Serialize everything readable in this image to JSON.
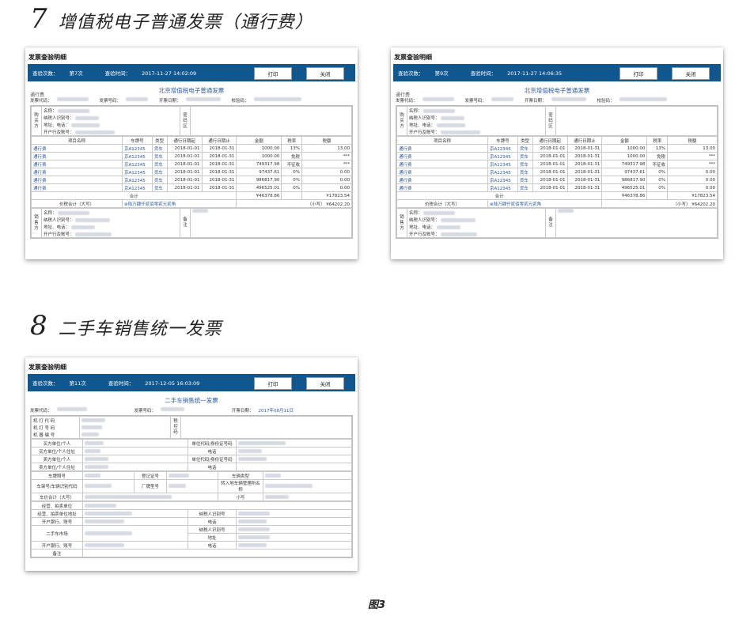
{
  "sections": [
    {
      "num": "7",
      "title": "增值税电子普通发票（通行费）"
    },
    {
      "num": "8",
      "title": "二手车销售统一发票"
    }
  ],
  "card_common": {
    "head": "发票查验明细",
    "print": "打印",
    "close": "关闭",
    "count_label": "查验次数：",
    "time_label": "查验时间："
  },
  "toll": {
    "tag": "通行费",
    "title": "北京增值税电子普通发票",
    "meta": [
      "发票代码：",
      "发票号码：",
      "开票日期：",
      "校验码："
    ],
    "buyer_label": "购买方",
    "buyer_fields": [
      "名称：",
      "纳税人识别号：",
      "地址、电话：",
      "开户行及账号："
    ],
    "pw_label": "密码区",
    "headers": [
      "项目名称",
      "车牌号",
      "类型",
      "通行日期起",
      "通行日期止",
      "金额",
      "税率",
      "税额"
    ],
    "rows": [
      [
        "通行费",
        "京A12345",
        "货车",
        "2018-01-01",
        "2018-01-31",
        "1000.00",
        "13%",
        "13.00"
      ],
      [
        "通行费",
        "京A12345",
        "货车",
        "2018-01-01",
        "2018-01-31",
        "1000.00",
        "免税",
        "***"
      ],
      [
        "通行费",
        "京A12345",
        "货车",
        "2018-01-01",
        "2018-01-31",
        "749317.98",
        "不征收",
        "***"
      ],
      [
        "通行费",
        "京A12345",
        "货车",
        "2018-01-01",
        "2018-01-31",
        "97437.61",
        "0%",
        "0.00"
      ],
      [
        "通行费",
        "京A12345",
        "货车",
        "2018-01-01",
        "2018-01-31",
        "986817.90",
        "0%",
        "0.00"
      ],
      [
        "通行费",
        "京A12345",
        "货车",
        "2018-01-01",
        "2018-01-31",
        "496525.01",
        "0%",
        "0.00"
      ]
    ],
    "total_label": "合计",
    "total_amount": "¥46378.86",
    "total_tax": "¥17823.54",
    "sum_label": "价税合计（大写）",
    "sum_upper": "⊗陆万肆仟贰佰零贰元贰角",
    "sum_lower_label": "（小写）",
    "sum_lower": "¥64202.20",
    "seller_label": "销售方",
    "seller_fields": [
      "名称：",
      "纳税人识别号：",
      "地址、电话：",
      "开户行及账号："
    ],
    "note_label": "备注"
  },
  "card1": {
    "count": "第7次",
    "time": "2017-11-27 14:02:09"
  },
  "card2": {
    "count": "第9次",
    "time": "2017-11-27 14:06:35"
  },
  "card3": {
    "count": "第11次",
    "time": "2017-12-05 16:03:09",
    "title": "二手车销售统一发票",
    "meta_code": "发票代码：",
    "meta_no": "发票号码：",
    "meta_date": "开票日期：",
    "date_value": "2017年08月11日",
    "machine": [
      "机 打 代 码",
      "机 打 号 码",
      "机 器 编 号"
    ],
    "tax_ctrl": "税控码",
    "rows": [
      [
        "买方单位/个人",
        "单位代码/身份证号码"
      ],
      [
        "买方单位/个人住址",
        "电话"
      ],
      [
        "卖方单位/个人",
        "单位代码/身份证号码"
      ],
      [
        "卖方单位/个人住址",
        "电话"
      ]
    ],
    "plate": "车牌照号",
    "reg": "登记证号",
    "vtype": "车辆类型",
    "vin": "车架号/车辆识别代码",
    "model": "厂牌型号",
    "transfer": "转入地车辆管理所名称",
    "price": "车价合计（大写）",
    "small": "小写",
    "auction": "经营、拍卖单位",
    "auction_addr": "经营、拍卖单位地址",
    "taxid": "纳税人识别号",
    "bank": "开户银行、账号",
    "phone": "电话",
    "market": "二手车市场",
    "market_taxid": "纳税人识别号",
    "address": "地址",
    "bank2": "开户银行、账号",
    "phone2": "电话",
    "note": "备注"
  },
  "caption": "图3"
}
